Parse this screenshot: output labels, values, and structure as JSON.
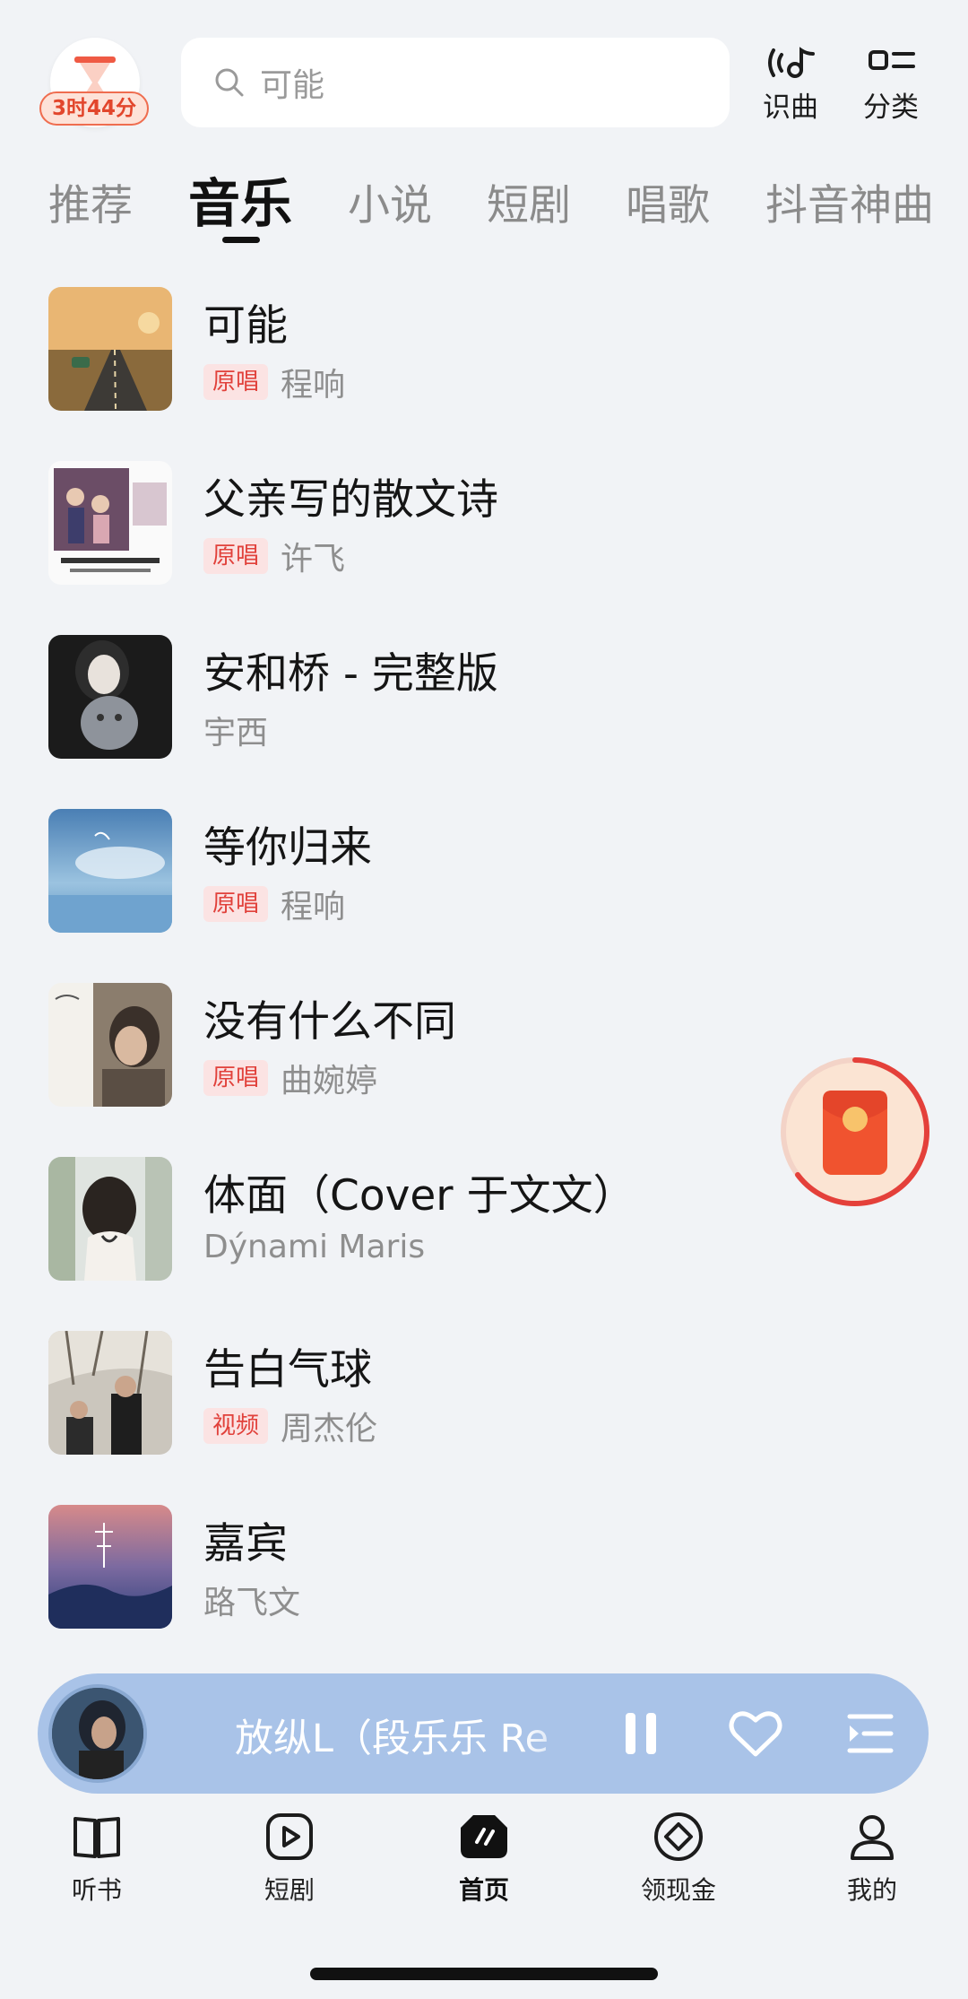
{
  "timer": {
    "label": "3时44分"
  },
  "search": {
    "placeholder": "可能"
  },
  "tools": [
    {
      "label": "识曲",
      "icon": "music-recognition-icon"
    },
    {
      "label": "分类",
      "icon": "category-icon"
    }
  ],
  "tabs": [
    "推荐",
    "音乐",
    "小说",
    "短剧",
    "唱歌",
    "抖音神曲"
  ],
  "active_tab": "音乐",
  "songs": [
    {
      "title": "可能",
      "tag": "原唱",
      "artist": "程响"
    },
    {
      "title": "父亲写的散文诗",
      "tag": "原唱",
      "artist": "许飞"
    },
    {
      "title": "安和桥 - 完整版",
      "tag": "",
      "artist": "宇西"
    },
    {
      "title": "等你归来",
      "tag": "原唱",
      "artist": "程响"
    },
    {
      "title": "没有什么不同",
      "tag": "原唱",
      "artist": "曲婉婷"
    },
    {
      "title": "体面（Cover 于文文）",
      "tag": "",
      "artist": "Dýnami Maris"
    },
    {
      "title": "告白气球",
      "tag": "视频",
      "artist": "周杰伦"
    },
    {
      "title": "嘉宾",
      "tag": "",
      "artist": "路飞文"
    }
  ],
  "player": {
    "title": "放纵L（段乐乐 Re",
    "state": "playing"
  },
  "nav": [
    {
      "label": "听书",
      "icon": "book-icon"
    },
    {
      "label": "短剧",
      "icon": "play-icon"
    },
    {
      "label": "首页",
      "icon": "home-icon"
    },
    {
      "label": "领现金",
      "icon": "cash-icon"
    },
    {
      "label": "我的",
      "icon": "profile-icon"
    }
  ],
  "active_nav": "首页",
  "colors": {
    "background": "#f1f3f6",
    "tag_bg": "#fbe3e3",
    "tag_text": "#e1413b",
    "player_bg": "#a9c3e8",
    "accent_red": "#e2462c"
  }
}
